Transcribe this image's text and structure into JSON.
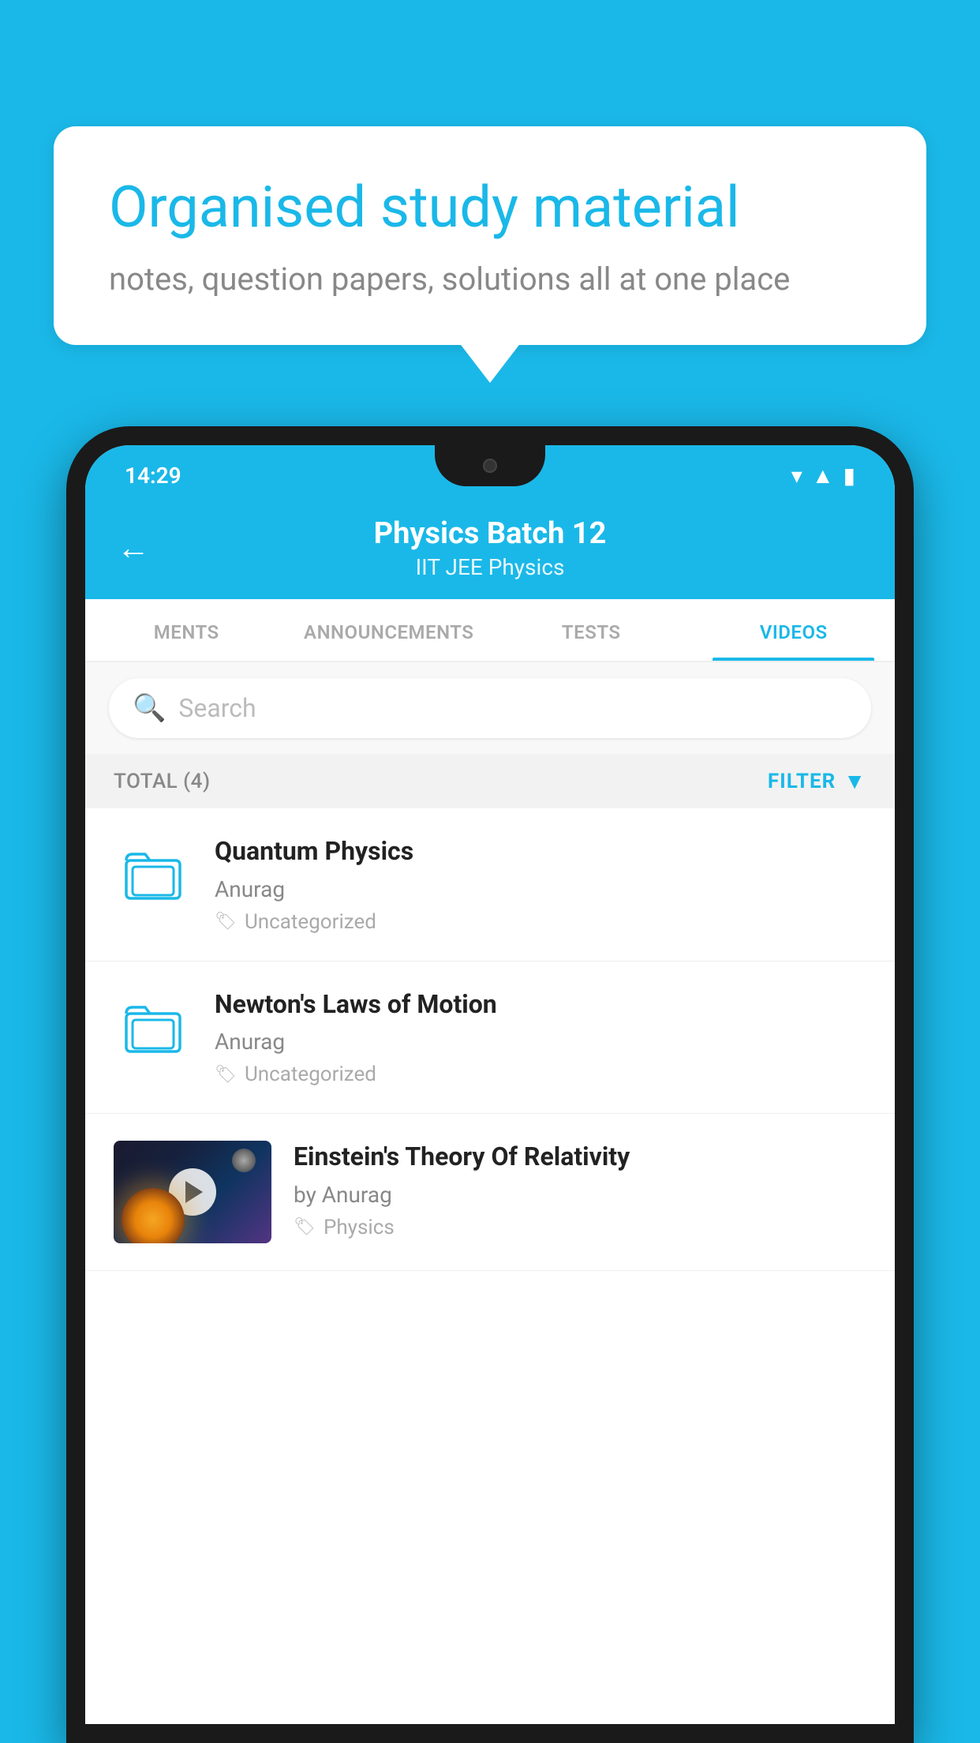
{
  "background_color": "#1ab8e8",
  "bubble": {
    "title": "Organised study material",
    "subtitle": "notes, question papers, solutions all at one place"
  },
  "status_bar": {
    "time": "14:29",
    "wifi": "▼",
    "signal": "▲",
    "battery": "▮"
  },
  "header": {
    "back_label": "←",
    "title": "Physics Batch 12",
    "subtitle": "IIT JEE   Physics"
  },
  "tabs": [
    {
      "id": "ments",
      "label": "MENTS",
      "active": false
    },
    {
      "id": "announcements",
      "label": "ANNOUNCEMENTS",
      "active": false
    },
    {
      "id": "tests",
      "label": "TESTS",
      "active": false
    },
    {
      "id": "videos",
      "label": "VIDEOS",
      "active": true
    }
  ],
  "search": {
    "placeholder": "Search"
  },
  "filter_bar": {
    "total_label": "TOTAL (4)",
    "filter_label": "FILTER"
  },
  "videos": [
    {
      "id": 1,
      "title": "Quantum Physics",
      "author": "Anurag",
      "tag": "Uncategorized",
      "has_thumb": false
    },
    {
      "id": 2,
      "title": "Newton's Laws of Motion",
      "author": "Anurag",
      "tag": "Uncategorized",
      "has_thumb": false
    },
    {
      "id": 3,
      "title": "Einstein's Theory Of Relativity",
      "author": "by Anurag",
      "tag": "Physics",
      "has_thumb": true
    }
  ]
}
